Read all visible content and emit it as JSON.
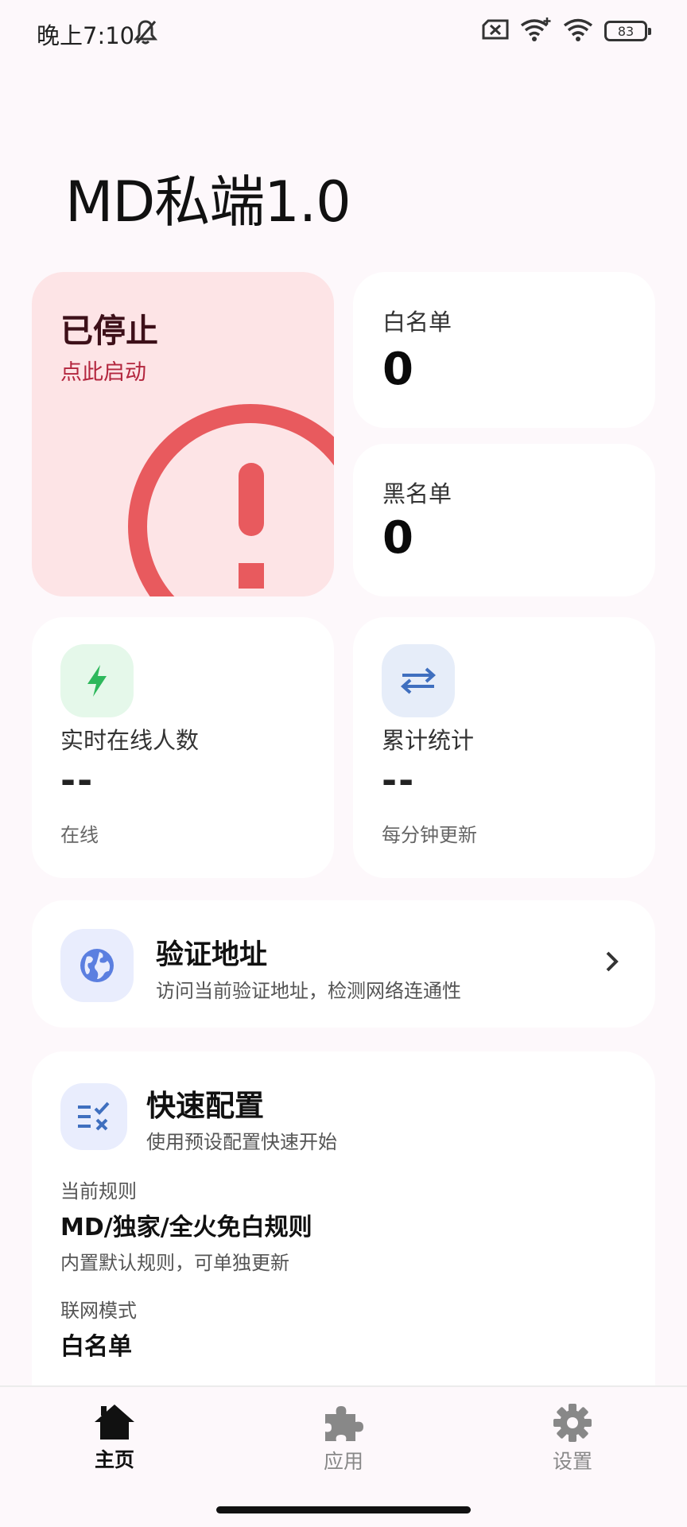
{
  "status_bar": {
    "time": "晚上7:10",
    "battery": "83"
  },
  "app": {
    "title": "MD私端1.0"
  },
  "service_status": {
    "title": "已停止",
    "subtitle": "点此启动",
    "accent": "#e85a5e"
  },
  "lists": {
    "whitelist_label": "白名单",
    "whitelist_count": "0",
    "blacklist_label": "黑名单",
    "blacklist_count": "0"
  },
  "stats": {
    "online": {
      "label": "实时在线人数",
      "value": "--",
      "sub": "在线",
      "icon": "bolt-icon"
    },
    "total": {
      "label": "累计统计",
      "value": "--",
      "sub": "每分钟更新",
      "icon": "swap-arrows-icon"
    }
  },
  "verify": {
    "title": "验证地址",
    "desc": "访问当前验证地址，检测网络连通性",
    "icon": "globe-icon"
  },
  "quick_config": {
    "title": "快速配置",
    "desc": "使用预设配置快速开始",
    "current_rule_label": "当前规则",
    "current_rule_value": "MD/独家/全火免白规则",
    "current_rule_note": "内置默认规则，可单独更新",
    "network_mode_label": "联网模式",
    "network_mode_value": "白名单"
  },
  "bottom_nav": {
    "home": "主页",
    "apps": "应用",
    "settings": "设置"
  }
}
